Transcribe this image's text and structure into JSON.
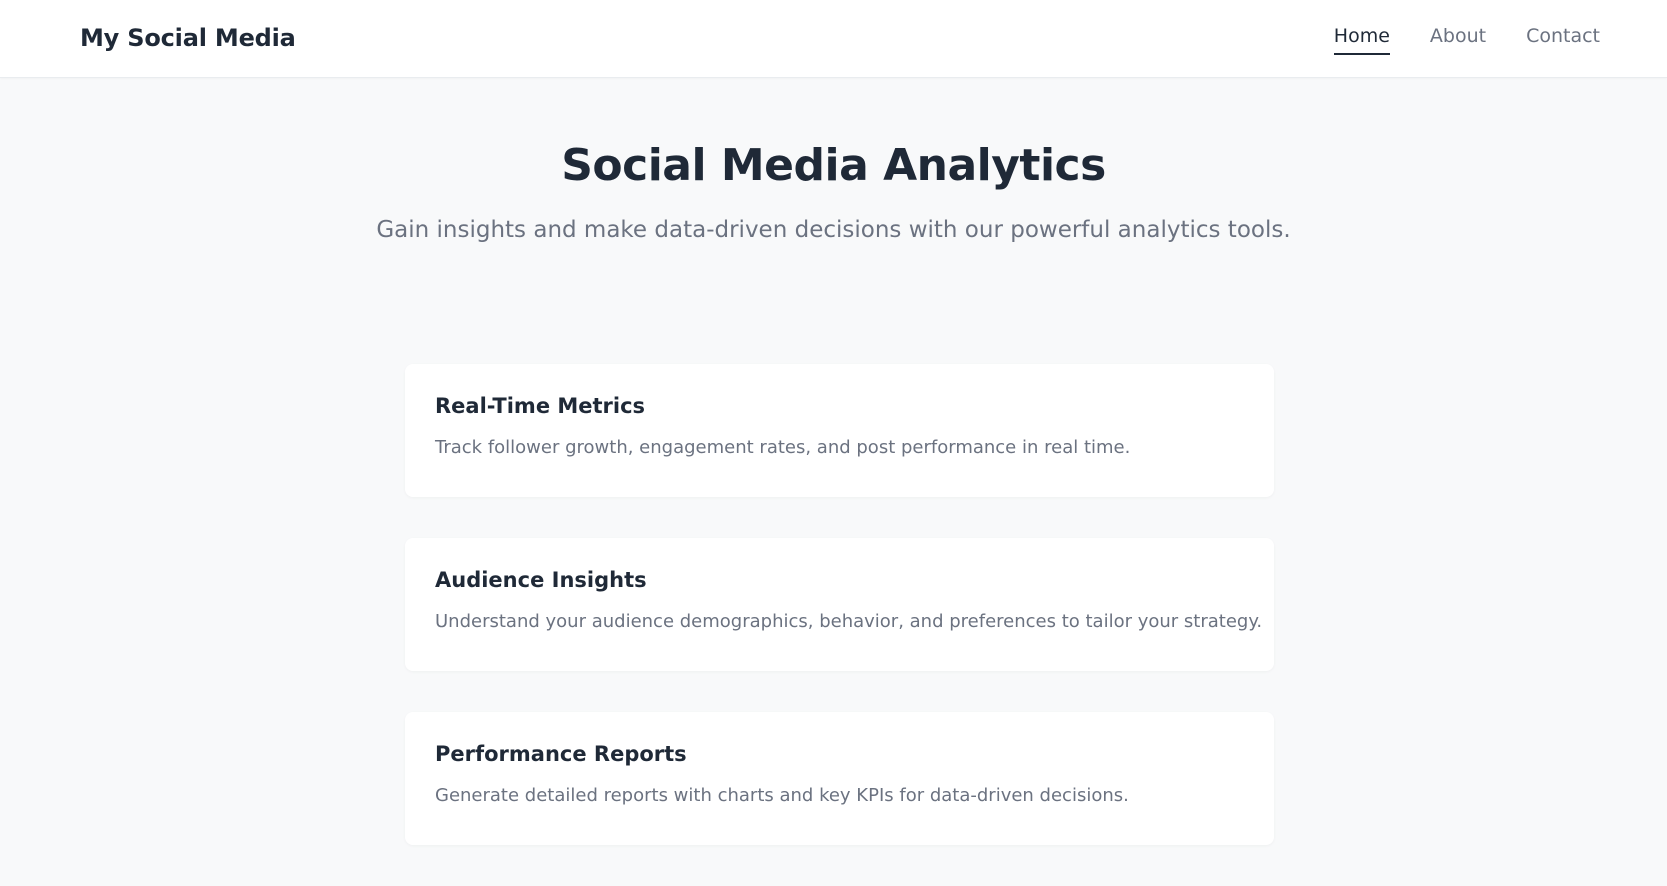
{
  "header": {
    "brand": "My Social Media",
    "nav": [
      {
        "label": "Home",
        "active": true
      },
      {
        "label": "About",
        "active": false
      },
      {
        "label": "Contact",
        "active": false
      }
    ]
  },
  "hero": {
    "title": "Social Media Analytics",
    "subtitle": "Gain insights and make data-driven decisions with our powerful analytics tools."
  },
  "features": [
    {
      "title": "Real-Time Metrics",
      "description": "Track follower growth, engagement rates, and post performance in real time."
    },
    {
      "title": "Audience Insights",
      "description": "Understand your audience demographics, behavior, and preferences to tailor your strategy."
    },
    {
      "title": "Performance Reports",
      "description": "Generate detailed reports with charts and key KPIs for data-driven decisions."
    }
  ],
  "colors": {
    "background": "#f8f9fa",
    "text_primary": "#1f2937",
    "text_secondary": "#6b7280",
    "card_background": "#ffffff"
  }
}
